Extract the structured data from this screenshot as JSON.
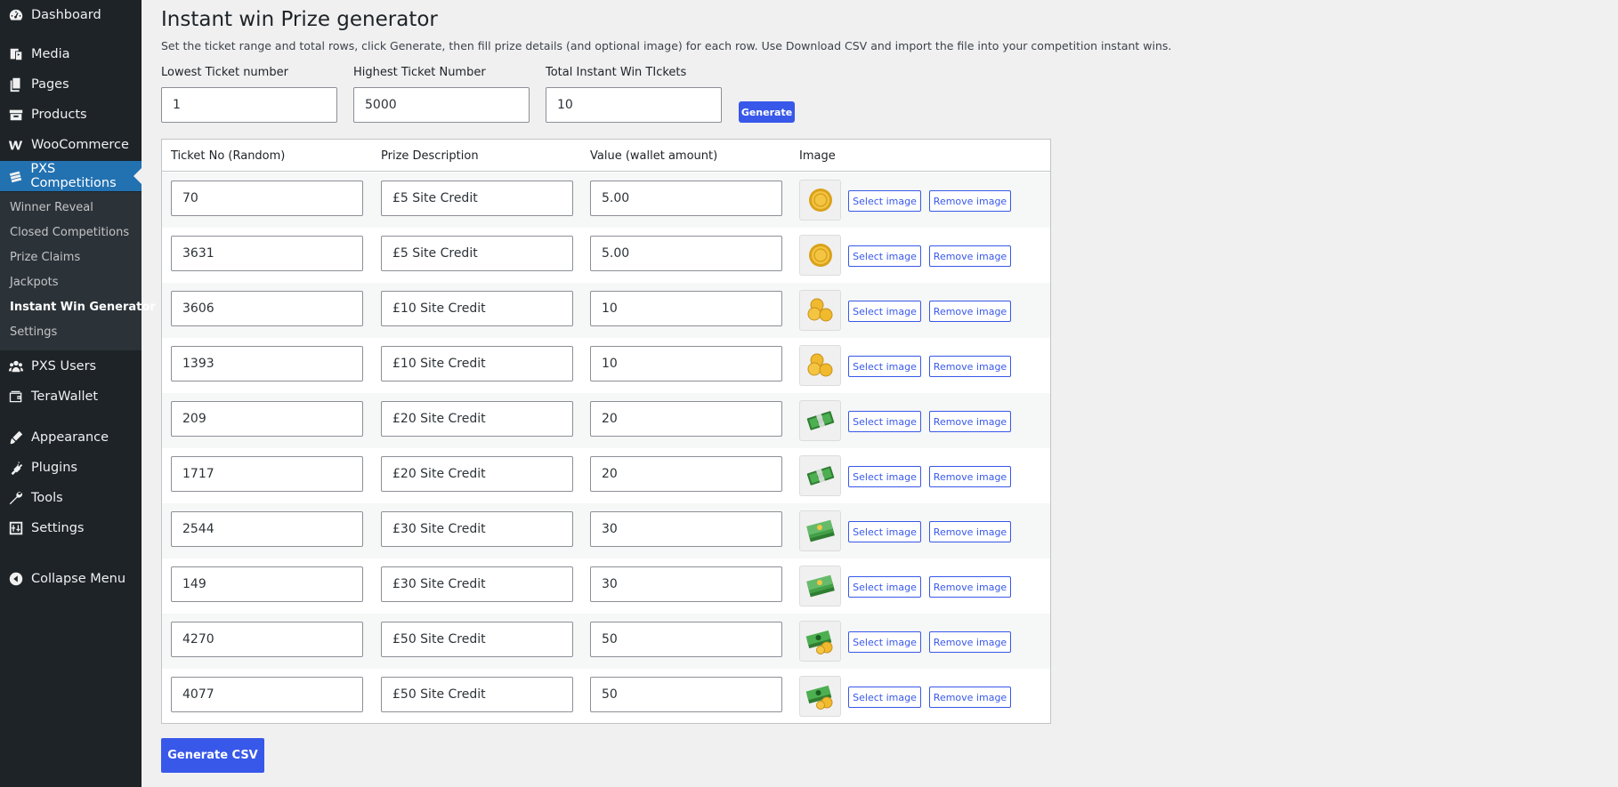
{
  "sidebar": {
    "menu": [
      {
        "label": "Dashboard",
        "icon": "dashboard-icon"
      },
      {
        "label": "Media",
        "icon": "media-icon"
      },
      {
        "label": "Pages",
        "icon": "pages-icon"
      },
      {
        "label": "Products",
        "icon": "products-icon"
      },
      {
        "label": "WooCommerce",
        "icon": "woocommerce-icon"
      },
      {
        "label": "PXS Competitions",
        "icon": "competitions-icon"
      },
      {
        "label": "PXS Users",
        "icon": "users-icon"
      },
      {
        "label": "TeraWallet",
        "icon": "wallet-icon"
      },
      {
        "label": "Appearance",
        "icon": "appearance-icon"
      },
      {
        "label": "Plugins",
        "icon": "plugins-icon"
      },
      {
        "label": "Tools",
        "icon": "tools-icon"
      },
      {
        "label": "Settings",
        "icon": "settings-icon"
      },
      {
        "label": "Collapse Menu",
        "icon": "collapse-icon"
      }
    ],
    "submenu": [
      {
        "label": "Winner Reveal"
      },
      {
        "label": "Closed Competitions"
      },
      {
        "label": "Prize Claims"
      },
      {
        "label": "Jackpots"
      },
      {
        "label": "Instant Win Generator"
      },
      {
        "label": "Settings"
      }
    ]
  },
  "page": {
    "title": "Instant win Prize generator",
    "description": "Set the ticket range and total rows, click Generate, then fill prize details (and optional image) for each row. Use Download CSV and import the file into your competition instant wins."
  },
  "form": {
    "lowest_label": "Lowest Ticket number",
    "lowest_value": "1",
    "highest_label": "Highest Ticket Number",
    "highest_value": "5000",
    "total_label": "Total Instant Win TIckets",
    "total_value": "10",
    "generate_label": "Generate"
  },
  "table": {
    "headers": [
      "Ticket No (Random)",
      "Prize Description",
      "Value (wallet amount)",
      "Image"
    ],
    "select_label": "Select image",
    "remove_label": "Remove image",
    "rows": [
      {
        "ticket": "70",
        "prize": "£5 Site Credit",
        "value": "5.00",
        "image": "gold-coin-icon"
      },
      {
        "ticket": "3631",
        "prize": "£5 Site Credit",
        "value": "5.00",
        "image": "gold-coin-icon"
      },
      {
        "ticket": "3606",
        "prize": "£10 Site Credit",
        "value": "10",
        "image": "coin-stack-icon"
      },
      {
        "ticket": "1393",
        "prize": "£10 Site Credit",
        "value": "10",
        "image": "coin-stack-icon"
      },
      {
        "ticket": "209",
        "prize": "£20 Site Credit",
        "value": "20",
        "image": "cash-bundle-icon"
      },
      {
        "ticket": "1717",
        "prize": "£20 Site Credit",
        "value": "20",
        "image": "cash-bundle-icon"
      },
      {
        "ticket": "2544",
        "prize": "£30 Site Credit",
        "value": "30",
        "image": "cash-stack-icon"
      },
      {
        "ticket": "149",
        "prize": "£30 Site Credit",
        "value": "30",
        "image": "cash-stack-icon"
      },
      {
        "ticket": "4270",
        "prize": "£50 Site Credit",
        "value": "50",
        "image": "cash-coins-icon"
      },
      {
        "ticket": "4077",
        "prize": "£50 Site Credit",
        "value": "50",
        "image": "cash-coins-icon"
      }
    ]
  },
  "footer": {
    "generate_csv_label": "Generate CSV"
  },
  "colors": {
    "sidebar_bg": "#1d2327",
    "submenu_bg": "#2c3338",
    "active_menu": "#2271b1",
    "accent_button": "#3858e9",
    "page_bg": "#f0f0f1"
  }
}
